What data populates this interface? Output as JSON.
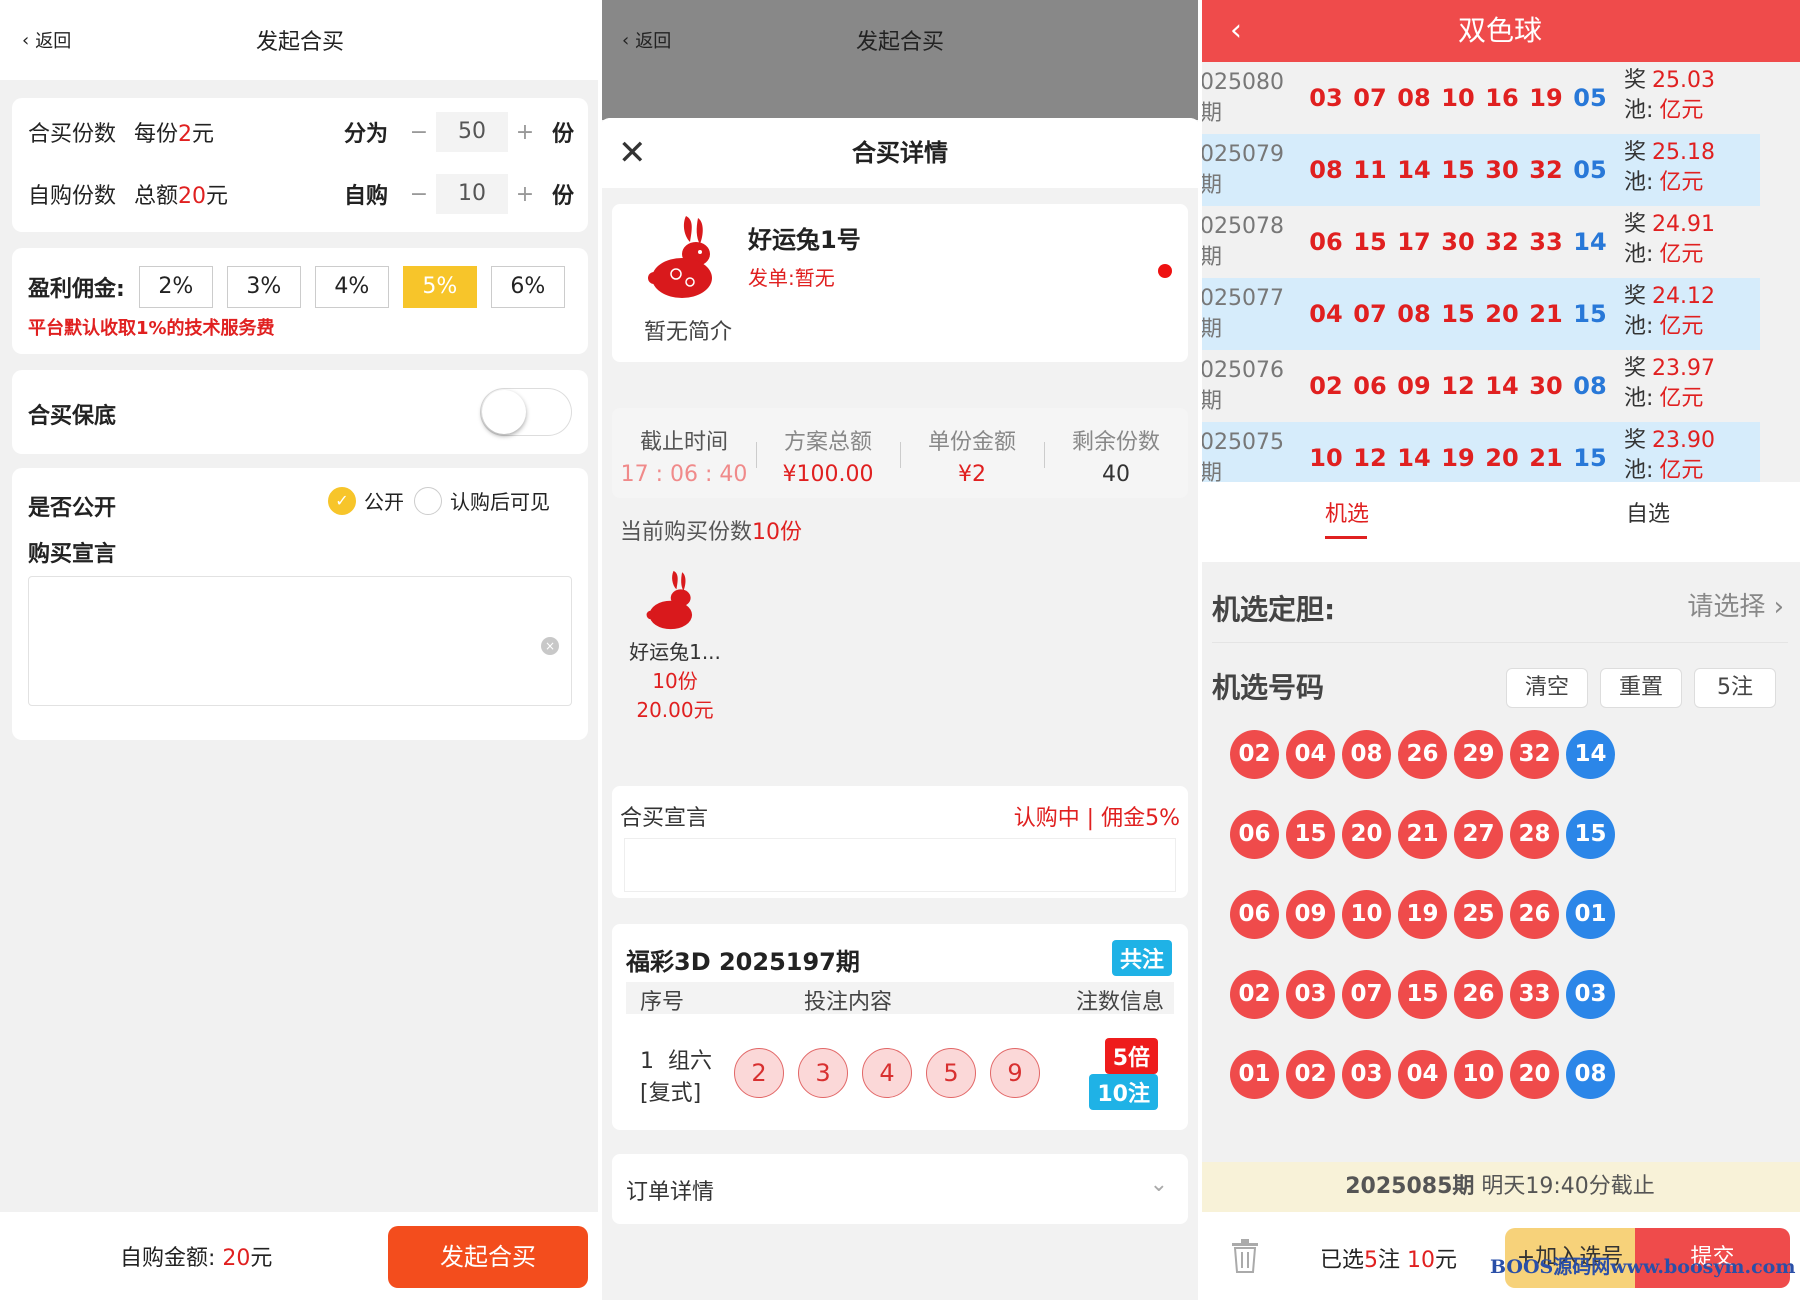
{
  "p1": {
    "back": "返回",
    "title": "发起合买",
    "share_label": "合买份数",
    "per_share": "每份",
    "per_share_val": "2",
    "per_share_unit": "元",
    "divide_label": "分为",
    "divide_val": "50",
    "unit": "份",
    "self_label": "自购份数",
    "total_label": "总额",
    "total_val": "20",
    "total_unit": "元",
    "self_buy": "自购",
    "self_val": "10",
    "commission_label": "盈利佣金:",
    "commissions": [
      "2%",
      "3%",
      "4%",
      "5%",
      "6%"
    ],
    "fee_note": "平台默认收取1%的技术服务费",
    "guarantee": "合买保底",
    "public_label": "是否公开",
    "opt_public": "公开",
    "opt_after": "认购后可见",
    "declaration": "购买宣言",
    "foot_label": "自购金额:",
    "foot_val": "20",
    "foot_unit": "元",
    "launch": "发起合买",
    "selected_commission": "5%"
  },
  "p2": {
    "back": "返回",
    "title": "发起合买",
    "sheet_title": "合买详情",
    "name": "好运兔1号",
    "issuer": "发单:暂无",
    "intro": "暂无简介",
    "stats": [
      {
        "label": "截止时间",
        "value": "17 : 06 : 40"
      },
      {
        "label": "方案总额",
        "value": "¥100.00"
      },
      {
        "label": "单份金额",
        "value": "¥2"
      },
      {
        "label": "剩余份数",
        "value": "40"
      }
    ],
    "current_prefix": "当前购买份数",
    "current_val": "10份",
    "buyer_name": "好运兔1...",
    "buyer_shares": "10份",
    "buyer_amount": "20.00元",
    "decl_label": "合买宣言",
    "decl_status": "认购中 | 佣金5%",
    "lottery_title": "福彩3D 2025197期",
    "tag_total": "共注",
    "col_no": "序号",
    "col_content": "投注内容",
    "col_info": "注数信息",
    "row_no": "1",
    "row_type": "组六",
    "row_sub": "[复式]",
    "balls": [
      "2",
      "3",
      "4",
      "5",
      "9"
    ],
    "mult": "5倍",
    "notes": "10注",
    "order": "订单详情"
  },
  "p3": {
    "title": "双色球",
    "history": [
      {
        "period": "025080期",
        "red": [
          "03",
          "07",
          "08",
          "10",
          "16",
          "19"
        ],
        "blue": "05",
        "pool_k1": "奖",
        "pool": "25.03",
        "pool_k2": "池:",
        "pool_unit": "亿元"
      },
      {
        "period": "025079期",
        "red": [
          "08",
          "11",
          "14",
          "15",
          "30",
          "32"
        ],
        "blue": "05",
        "pool_k1": "奖",
        "pool": "25.18",
        "pool_k2": "池:",
        "pool_unit": "亿元"
      },
      {
        "period": "025078期",
        "red": [
          "06",
          "15",
          "17",
          "30",
          "32",
          "33"
        ],
        "blue": "14",
        "pool_k1": "奖",
        "pool": "24.91",
        "pool_k2": "池:",
        "pool_unit": "亿元"
      },
      {
        "period": "025077期",
        "red": [
          "04",
          "07",
          "08",
          "15",
          "20",
          "21"
        ],
        "blue": "15",
        "pool_k1": "奖",
        "pool": "24.12",
        "pool_k2": "池:",
        "pool_unit": "亿元"
      },
      {
        "period": "025076期",
        "red": [
          "02",
          "06",
          "09",
          "12",
          "14",
          "30"
        ],
        "blue": "08",
        "pool_k1": "奖",
        "pool": "23.97",
        "pool_k2": "池:",
        "pool_unit": "亿元"
      },
      {
        "period": "025075期",
        "red": [
          "10",
          "12",
          "14",
          "19",
          "20",
          "21"
        ],
        "blue": "15",
        "pool_k1": "奖",
        "pool": "23.90",
        "pool_k2": "池:",
        "pool_unit": "亿元"
      }
    ],
    "tab_machine": "机选",
    "tab_self": "自选",
    "fixed_label": "机选定胆:",
    "fixed_select": "请选择",
    "pick_label": "机选号码",
    "btn_clear": "清空",
    "btn_reset": "重置",
    "btn_five": "5注",
    "picks": [
      {
        "red": [
          "02",
          "04",
          "08",
          "26",
          "29",
          "32"
        ],
        "blue": "14"
      },
      {
        "red": [
          "06",
          "15",
          "20",
          "21",
          "27",
          "28"
        ],
        "blue": "15"
      },
      {
        "red": [
          "06",
          "09",
          "10",
          "19",
          "25",
          "26"
        ],
        "blue": "01"
      },
      {
        "red": [
          "02",
          "03",
          "07",
          "15",
          "26",
          "33"
        ],
        "blue": "03"
      },
      {
        "red": [
          "01",
          "02",
          "03",
          "04",
          "10",
          "20"
        ],
        "blue": "08"
      }
    ],
    "deadline_period": "2025085期",
    "deadline_text": "明天19:40分截止",
    "sel_prefix": "已选",
    "sel_notes": "5",
    "sel_mid": "注",
    "sel_amount": "10",
    "sel_unit": "元",
    "add_btn": "+加入选号",
    "submit_btn": "提交",
    "watermark": "BOOS源码网www.boosym.com"
  },
  "colors": {
    "accent_red": "#ef4b4b",
    "blue_ball": "#2b86e8",
    "yellow": "#f7c52a",
    "orange": "#f34d1d"
  }
}
